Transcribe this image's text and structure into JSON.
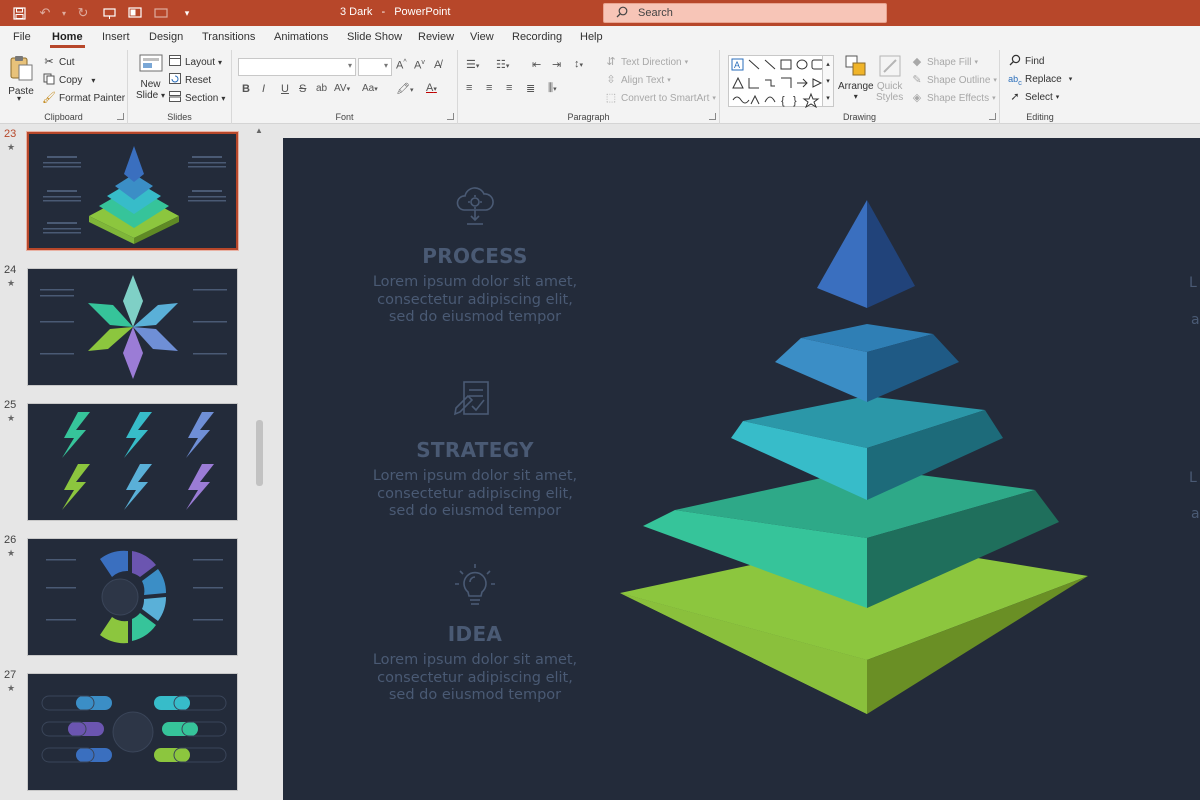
{
  "titlebar": {
    "doc_name": "3 Dark",
    "separator": "-",
    "app_name": "PowerPoint",
    "search_placeholder": "Search"
  },
  "tabs": [
    {
      "label": "File"
    },
    {
      "label": "Home",
      "active": true
    },
    {
      "label": "Insert"
    },
    {
      "label": "Design"
    },
    {
      "label": "Transitions"
    },
    {
      "label": "Animations"
    },
    {
      "label": "Slide Show"
    },
    {
      "label": "Review"
    },
    {
      "label": "View"
    },
    {
      "label": "Recording"
    },
    {
      "label": "Help"
    }
  ],
  "ribbon": {
    "clipboard": {
      "label": "Clipboard",
      "paste": "Paste",
      "cut": "Cut",
      "copy": "Copy",
      "format_painter": "Format Painter"
    },
    "slides": {
      "label": "Slides",
      "new_slide_line1": "New",
      "new_slide_line2": "Slide",
      "layout": "Layout",
      "reset": "Reset",
      "section": "Section"
    },
    "font": {
      "label": "Font",
      "bold": "B",
      "italic": "I",
      "underline": "U",
      "strike": "S",
      "spacing": "AV",
      "case": "Aa"
    },
    "paragraph": {
      "label": "Paragraph",
      "text_direction": "Text Direction",
      "align_text": "Align Text",
      "convert_smartart": "Convert to SmartArt"
    },
    "drawing": {
      "label": "Drawing",
      "arrange": "Arrange",
      "quick_styles_line1": "Quick",
      "quick_styles_line2": "Styles",
      "shape_fill": "Shape Fill",
      "shape_outline": "Shape Outline",
      "shape_effects": "Shape Effects"
    },
    "editing": {
      "label": "Editing",
      "find": "Find",
      "replace": "Replace",
      "select": "Select"
    }
  },
  "thumbnails": [
    {
      "number": "23",
      "star": "★",
      "active": true
    },
    {
      "number": "24",
      "star": "★",
      "active": false
    },
    {
      "number": "25",
      "star": "★",
      "active": false
    },
    {
      "number": "26",
      "star": "★",
      "active": false
    },
    {
      "number": "27",
      "star": "★",
      "active": false
    }
  ],
  "slide": {
    "items": [
      {
        "title": "PROCESS",
        "icon": "cloud-gear-icon",
        "body": "Lorem ipsum dolor sit amet, consectetur adipiscing elit, sed do eiusmod tempor"
      },
      {
        "title": "STRATEGY",
        "icon": "document-pen-icon",
        "body": "Lorem ipsum dolor sit amet, consectetur adipiscing elit, sed do eiusmod tempor"
      },
      {
        "title": "IDEA",
        "icon": "lightbulb-icon",
        "body": "Lorem ipsum dolor sit amet, consectetur adipiscing elit, sed do eiusmod tempor"
      }
    ],
    "edge_fragments": [
      "L",
      "a",
      "L",
      "a"
    ],
    "colors": {
      "background": "#232b3a",
      "text": "#4a5a74",
      "tier_colors": [
        "#3a6fbf",
        "#3b8ec6",
        "#37bcc9",
        "#36c49a",
        "#8cc63e"
      ]
    }
  }
}
